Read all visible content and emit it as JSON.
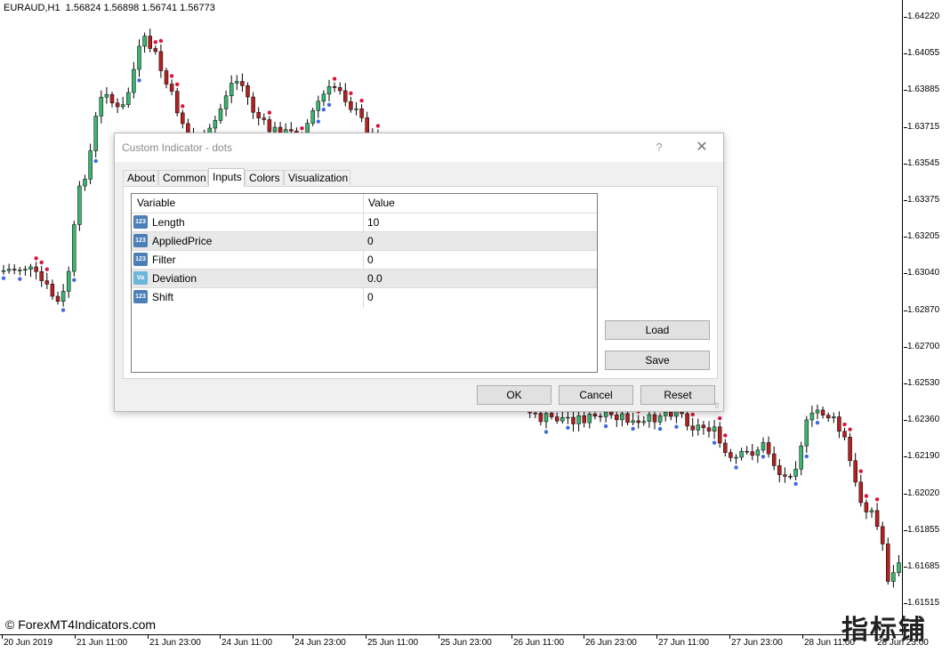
{
  "chart": {
    "header": "EURAUD,H1  1.56824 1.56898 1.56741 1.56773",
    "price_labels": [
      "1.64220",
      "1.64055",
      "1.63885",
      "1.63715",
      "1.63545",
      "1.63375",
      "1.63205",
      "1.63040",
      "1.62870",
      "1.62700",
      "1.62530",
      "1.62360",
      "1.62190",
      "1.62020",
      "1.61855",
      "1.61685",
      "1.61515"
    ],
    "time_labels": [
      "20 Jun 2019",
      "21 Jun 11:00",
      "21 Jun 23:00",
      "24 Jun 11:00",
      "24 Jun 23:00",
      "25 Jun 11:00",
      "25 Jun 23:00",
      "26 Jun 11:00",
      "26 Jun 23:00",
      "27 Jun 11:00",
      "27 Jun 23:00",
      "28 Jun 11:00",
      "28 Jun 23:00"
    ],
    "colors": {
      "bull": "#3cb371",
      "bear": "#b22222",
      "dot_up": "#4169e1",
      "dot_down": "#dc143c"
    },
    "watermark": "© ForexMT4Indicators.com",
    "logo": "指标铺"
  },
  "dialog": {
    "title": "Custom Indicator - dots",
    "help": "?",
    "close": "✕",
    "tabs": [
      "About",
      "Common",
      "Inputs",
      "Colors",
      "Visualization"
    ],
    "active_tab": "Inputs",
    "columns": {
      "variable": "Variable",
      "value": "Value"
    },
    "params": [
      {
        "icon": "123",
        "name": "Length",
        "value": "10"
      },
      {
        "icon": "123",
        "name": "AppliedPrice",
        "value": "0"
      },
      {
        "icon": "123",
        "name": "Filter",
        "value": "0"
      },
      {
        "icon": "Va",
        "name": "Deviation",
        "value": "0.0"
      },
      {
        "icon": "123",
        "name": "Shift",
        "value": "0"
      }
    ],
    "buttons": {
      "load": "Load",
      "save": "Save",
      "ok": "OK",
      "cancel": "Cancel",
      "reset": "Reset"
    }
  }
}
